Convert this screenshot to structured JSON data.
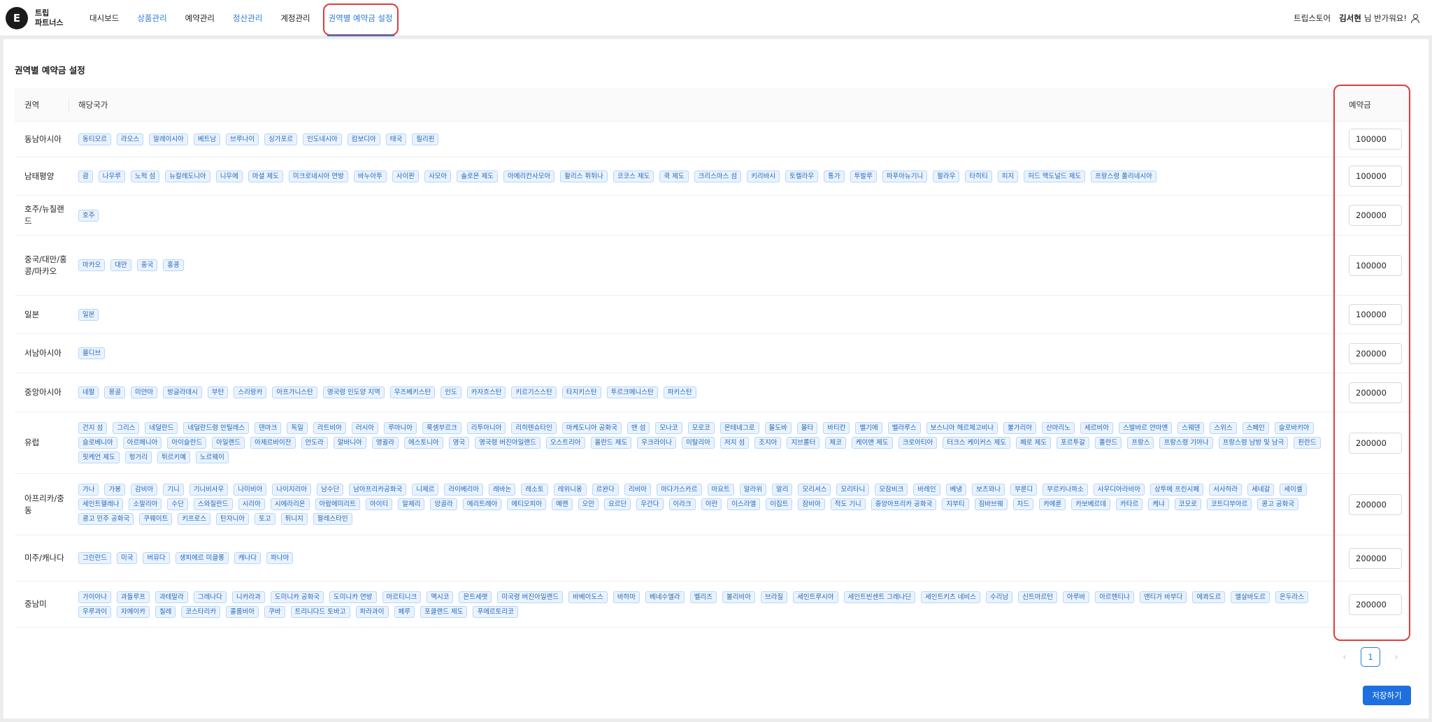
{
  "header": {
    "logo_letter": "E",
    "logo_line1": "트립",
    "logo_line2": "파트너스",
    "nav": [
      {
        "label": "대시보드",
        "style": "normal"
      },
      {
        "label": "상품관리",
        "style": "blue"
      },
      {
        "label": "예약관리",
        "style": "normal"
      },
      {
        "label": "정산관리",
        "style": "blue"
      },
      {
        "label": "계정관리",
        "style": "normal"
      },
      {
        "label": "권역별 예약금 설정",
        "style": "active"
      }
    ],
    "store": "트립스토어",
    "user_name": "김서현",
    "greeting": "님 반가워요!"
  },
  "page": {
    "title": "권역별 예약금 설정"
  },
  "table": {
    "columns": {
      "region": "권역",
      "countries": "해당국가",
      "fee": "예약금"
    },
    "rows": [
      {
        "region": "동남아시아",
        "fee": "100000",
        "countries": [
          "동티모르",
          "라오스",
          "말레이시아",
          "베트남",
          "브루나이",
          "싱가포르",
          "인도네시아",
          "캄보디아",
          "태국",
          "필리핀"
        ]
      },
      {
        "region": "남태평양",
        "fee": "100000",
        "countries": [
          "괌",
          "나우루",
          "노퍽 섬",
          "뉴칼레도니아",
          "니우에",
          "마셜 제도",
          "미크로네시아 연방",
          "바누아투",
          "사이판",
          "사모아",
          "솔로몬 제도",
          "아메리칸사모아",
          "왈리스 퓌튀나",
          "코코스 제도",
          "쿡 제도",
          "크리스마스 섬",
          "키리바시",
          "토켈라우",
          "통가",
          "투발루",
          "파푸아뉴기니",
          "팔라우",
          "타히티",
          "피지",
          "허드 맥도널드 제도",
          "프랑스령 폴리네시아"
        ]
      },
      {
        "region": "호주/뉴질랜드",
        "fee": "200000",
        "countries": [
          "호주"
        ]
      },
      {
        "region": "중국/대만/홍콩/마카오",
        "fee": "100000",
        "countries": [
          "마카오",
          "대만",
          "중국",
          "홍콩"
        ]
      },
      {
        "region": "일본",
        "fee": "100000",
        "countries": [
          "일본"
        ]
      },
      {
        "region": "서남아시아",
        "fee": "200000",
        "countries": [
          "몰디브"
        ]
      },
      {
        "region": "중앙아시아",
        "fee": "200000",
        "countries": [
          "네팔",
          "몽골",
          "미얀마",
          "방글라데시",
          "부탄",
          "스리랑카",
          "아프가니스탄",
          "영국령 인도양 지역",
          "우즈베키스탄",
          "인도",
          "카자흐스탄",
          "키르기스스탄",
          "타지키스탄",
          "투르크메니스탄",
          "파키스탄"
        ]
      },
      {
        "region": "유럽",
        "fee": "200000",
        "countries": [
          "건지 섬",
          "그리스",
          "네덜란드",
          "네덜란드령 안틸레스",
          "덴마크",
          "독일",
          "라트비아",
          "러시아",
          "루마니아",
          "룩셈부르크",
          "리투아니아",
          "리히텐슈타인",
          "마케도니아 공화국",
          "맨 섬",
          "모나코",
          "모로코",
          "몬테네그로",
          "몰도바",
          "몰타",
          "바티칸",
          "벨기에",
          "벨라루스",
          "보스니아 헤르체고비나",
          "불가리아",
          "산마리노",
          "세르비아",
          "스발바르 얀마옌",
          "스웨덴",
          "스위스",
          "스페인",
          "슬로바키아",
          "슬로베니아",
          "아르메니아",
          "아이슬란드",
          "아일랜드",
          "아제르바이잔",
          "안도라",
          "알바니아",
          "앵귈라",
          "에스토니아",
          "영국",
          "영국령 버진아일랜드",
          "오스트리아",
          "올란드 제도",
          "우크라이나",
          "이탈리아",
          "저지 섬",
          "조지아",
          "지브롤터",
          "체코",
          "케이맨 제도",
          "크로아티아",
          "터크스 케이커스 제도",
          "페로 제도",
          "포르투갈",
          "폴란드",
          "프랑스",
          "프랑스령 기아나",
          "프랑스령 남방 및 남극",
          "핀란드",
          "핏케언 제도",
          "헝가리",
          "튀르키예",
          "노르웨이"
        ]
      },
      {
        "region": "아프리카/중동",
        "fee": "200000",
        "countries": [
          "가나",
          "가봉",
          "감비아",
          "기니",
          "기니비사우",
          "나미비아",
          "나이지리아",
          "남수단",
          "남아프리카공화국",
          "니제르",
          "라이베리아",
          "레바논",
          "레소토",
          "레위니옹",
          "르완다",
          "리비아",
          "마다가스카르",
          "마요트",
          "말라위",
          "말리",
          "모리셔스",
          "모리타니",
          "모잠비크",
          "바레인",
          "베냉",
          "보츠와나",
          "부룬디",
          "부르키나파소",
          "사우디아라비아",
          "상투메 프린시페",
          "서사하라",
          "세네갈",
          "세이셸",
          "세인트헬레나",
          "소말리아",
          "수단",
          "스와질란드",
          "시리아",
          "시에라리온",
          "아랍에미리트",
          "아이티",
          "알제리",
          "앙골라",
          "에리트레아",
          "에티오피아",
          "예멘",
          "오만",
          "요르단",
          "우간다",
          "이라크",
          "이란",
          "이스라엘",
          "이집트",
          "잠비아",
          "적도 기니",
          "중앙아프리카 공화국",
          "지부티",
          "짐바브웨",
          "차드",
          "카메룬",
          "카보베르데",
          "카타르",
          "케냐",
          "코모로",
          "코트디부아르",
          "콩고 공화국",
          "콩고 민주 공화국",
          "쿠웨이트",
          "키프로스",
          "탄자니아",
          "토고",
          "튀니지",
          "팔레스타인"
        ]
      },
      {
        "region": "미주/캐나다",
        "fee": "200000",
        "countries": [
          "그린란드",
          "미국",
          "버뮤다",
          "생피에르 미클롱",
          "캐나다",
          "파나마"
        ]
      },
      {
        "region": "중남미",
        "fee": "200000",
        "countries": [
          "가이아나",
          "과들루프",
          "과테말라",
          "그레나다",
          "니카라과",
          "도미니카 공화국",
          "도미니카 연방",
          "마르티니크",
          "멕시코",
          "몬트세랫",
          "미국령 버진아일랜드",
          "바베이도스",
          "바하마",
          "베네수엘라",
          "벨리즈",
          "볼리비아",
          "브라질",
          "세인트루시아",
          "세인트빈센트 그레나딘",
          "세인트키츠 네비스",
          "수리남",
          "신트마르턴",
          "아루바",
          "아르헨티나",
          "앤티가 바부다",
          "에콰도르",
          "엘살바도르",
          "온두라스",
          "우루과이",
          "자메이카",
          "칠레",
          "코스타리카",
          "콜롬비아",
          "쿠바",
          "트리니다드 토바고",
          "파라과이",
          "페루",
          "포클랜드 제도",
          "푸에르토리코"
        ]
      }
    ]
  },
  "pagination": {
    "current": "1",
    "prev_icon": "chevron-left-icon",
    "next_icon": "chevron-right-icon"
  },
  "actions": {
    "save_label": "저장하기"
  },
  "colors": {
    "accent": "#1e6fe0",
    "highlight": "#e23b3b",
    "tag_bg": "#e9f3ff",
    "tag_text": "#2766b5"
  }
}
